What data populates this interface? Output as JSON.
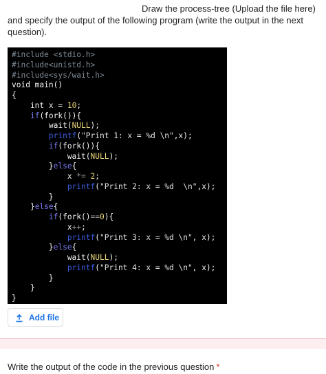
{
  "question1": {
    "line1": "Draw the process-tree (Upload the file here)",
    "line2": "and specify the output of the following program (write the output in the next",
    "line3": "question)."
  },
  "code": {
    "lines": [
      "#include <stdio.h>",
      "#include<unistd.h>",
      "#include<sys/wait.h>",
      "void main()",
      "{",
      "    int x = 10;",
      "    if(fork()){",
      "        wait(NULL);",
      "        printf(\"Print 1: x = %d \\n\",x);",
      "        if(fork()){",
      "            wait(NULL);",
      "        }else{",
      "            x *= 2;",
      "            printf(\"Print 2: x = %d  \\n\",x);",
      "        }",
      "    }else{",
      "        if(fork()==0){",
      "            x++;",
      "            printf(\"Print 3: x = %d \\n\", x);",
      "        }else{",
      "            wait(NULL);",
      "            printf(\"Print 4: x = %d \\n\", x);",
      "        }",
      "    }",
      "}"
    ]
  },
  "upload": {
    "button_label": "Add file",
    "icon": "upload-icon"
  },
  "colors": {
    "accent": "#1a73e8",
    "required": "#d93025",
    "divider_band": "#fdeef0"
  },
  "question2": {
    "label": "Write the output of the code in the previous question",
    "required_mark": "*"
  }
}
